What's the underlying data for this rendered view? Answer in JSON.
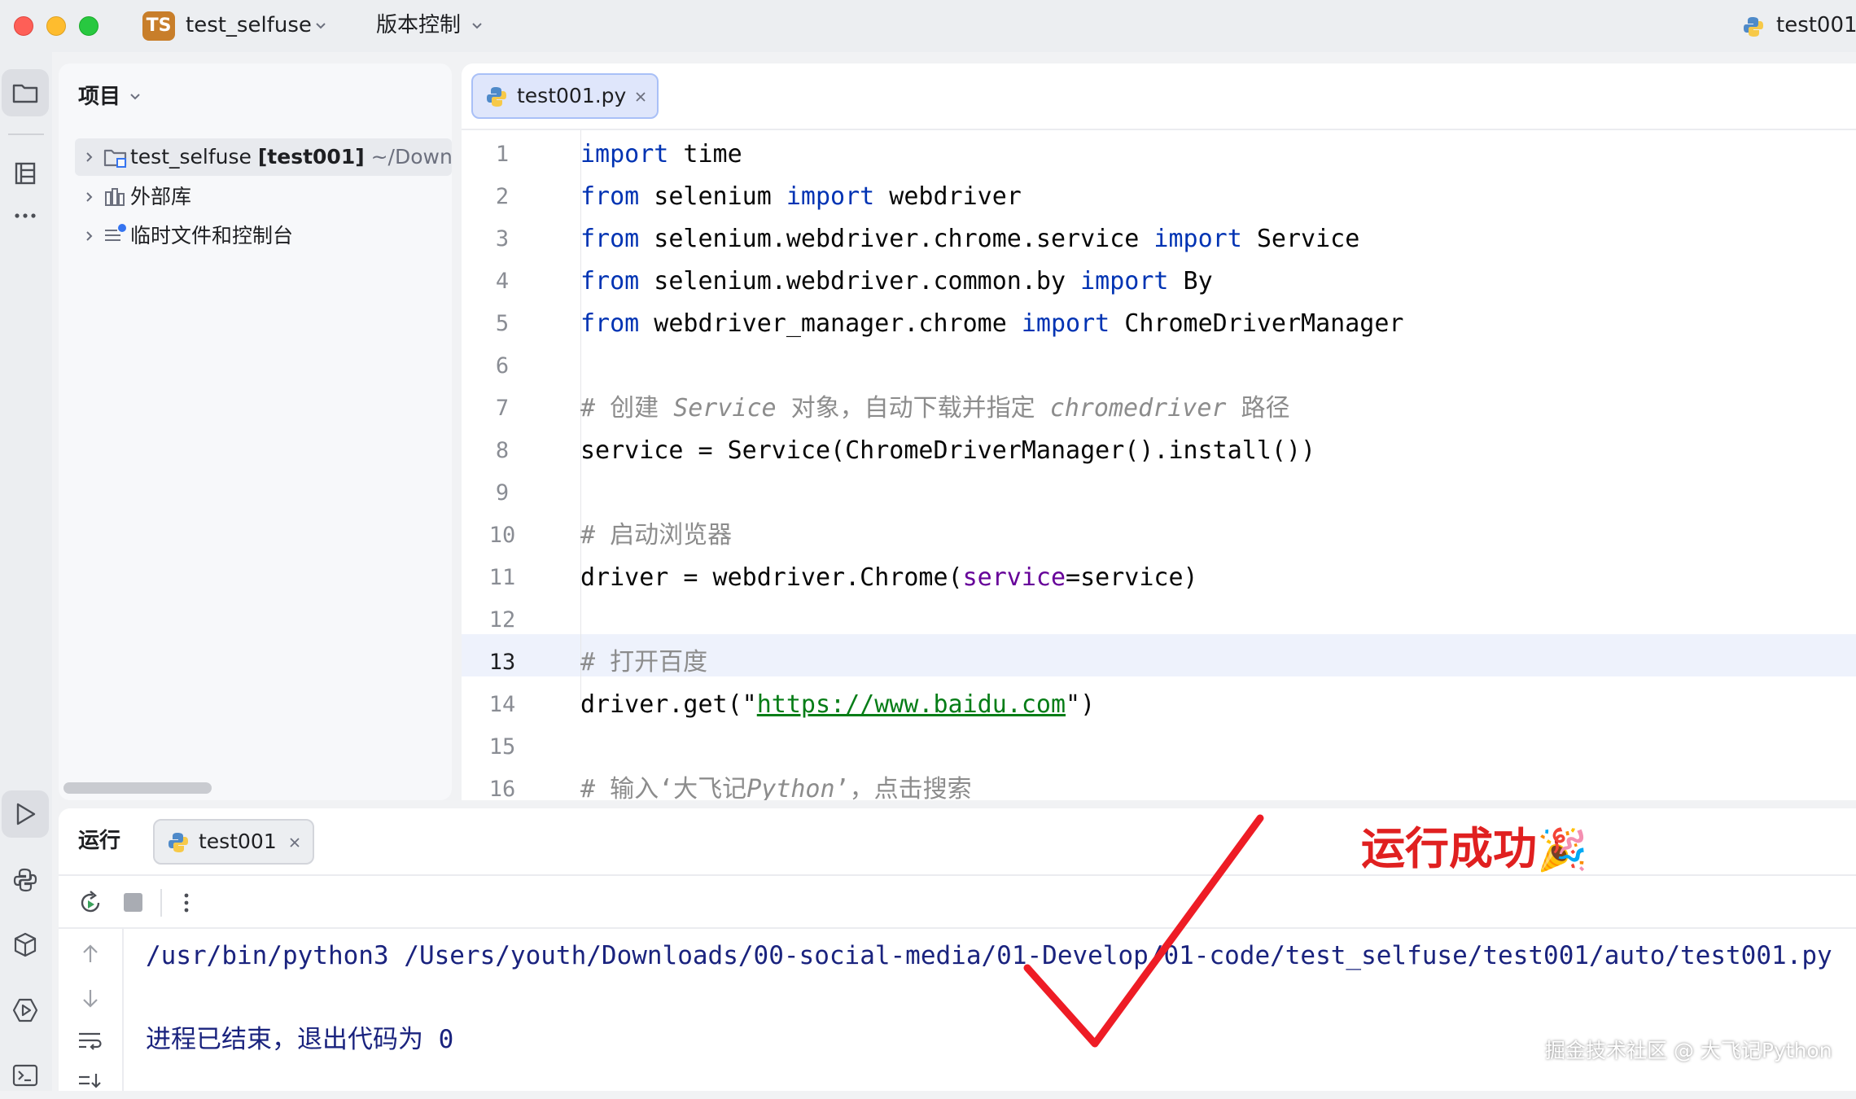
{
  "titlebar": {
    "project_badge": "TS",
    "project_name": "test_selfuse",
    "vcs_label": "版本控制",
    "run_config": "test001"
  },
  "project_panel": {
    "title": "项目",
    "tree": [
      {
        "name": "test_selfuse",
        "branch": "[test001]",
        "path": "~/Down"
      },
      {
        "name": "外部库"
      },
      {
        "name": "临时文件和控制台"
      }
    ]
  },
  "editor": {
    "tab_label": "test001.py",
    "line_numbers": [
      "1",
      "2",
      "3",
      "4",
      "5",
      "6",
      "7",
      "8",
      "9",
      "10",
      "11",
      "12",
      "13",
      "14",
      "15",
      "16"
    ],
    "code": {
      "l1": [
        "import",
        " time"
      ],
      "l2": [
        "from",
        " selenium ",
        "import",
        " webdriver"
      ],
      "l3": [
        "from",
        " selenium.webdriver.chrome.service ",
        "import",
        " Service"
      ],
      "l4": [
        "from",
        " selenium.webdriver.common.by ",
        "import",
        " By"
      ],
      "l5": [
        "from",
        " webdriver_manager.chrome ",
        "import",
        " ChromeDriverManager"
      ],
      "l7": [
        "# 创建 ",
        "Service",
        " 对象，自动下载并指定 ",
        "chromedriver",
        " 路径"
      ],
      "l8": "service = Service(ChromeDriverManager().install())",
      "l10": "# 启动浏览器",
      "l11": [
        "driver = webdriver.Chrome(",
        "service",
        "=service)"
      ],
      "l13": "# 打开百度",
      "l14": [
        "driver.get(\"",
        "https://www.baidu.com",
        "\")"
      ],
      "l16": [
        "# 输入‘大飞记",
        "Python",
        "’，点击搜索"
      ]
    },
    "current_line": "13"
  },
  "run_panel": {
    "title": "运行",
    "tab_label": "test001",
    "command": "/usr/bin/python3 /Users/youth/Downloads/00-social-media/01-Develop/01-code/test_selfuse/test001/auto/test001.py",
    "exit_message": "进程已结束，退出代码为 0"
  },
  "overlay": {
    "success_text": "运行成功",
    "success_emoji": "🎉",
    "watermark": "掘金技术社区 @ 大飞记Python",
    "check_color": "#ee1c25"
  },
  "icons": [
    "folder-icon",
    "structure-icon",
    "more-icon",
    "run-icon",
    "python-console-icon",
    "python-packages-icon",
    "services-icon",
    "terminal-icon",
    "rerun-icon",
    "stop-icon",
    "kebab-menu-icon",
    "arrow-up-icon",
    "arrow-down-icon",
    "soft-wrap-icon",
    "scroll-end-icon",
    "python-file-icon",
    "close-icon",
    "chevron-right-icon",
    "chevron-down-icon"
  ]
}
